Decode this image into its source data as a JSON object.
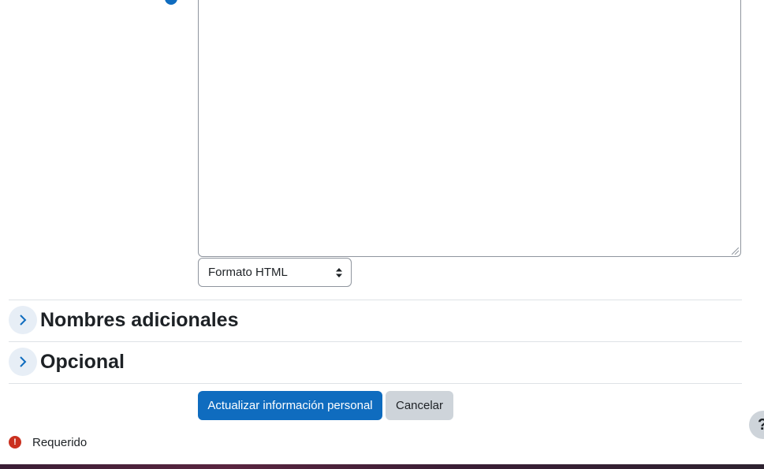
{
  "editor": {
    "format_select": {
      "selected": "Formato HTML"
    }
  },
  "sections": [
    {
      "title": "Nombres adicionales"
    },
    {
      "title": "Opcional"
    }
  ],
  "actions": {
    "submit_label": "Actualizar información personal",
    "cancel_label": "Cancelar"
  },
  "legend": {
    "required_label": "Requerido",
    "required_icon": "exclamation-circle-icon"
  },
  "help": {
    "label": "?"
  },
  "colors": {
    "primary": "#0f6cbf",
    "secondary": "#ced4da",
    "danger": "#ca3120",
    "text": "#1d2125"
  }
}
